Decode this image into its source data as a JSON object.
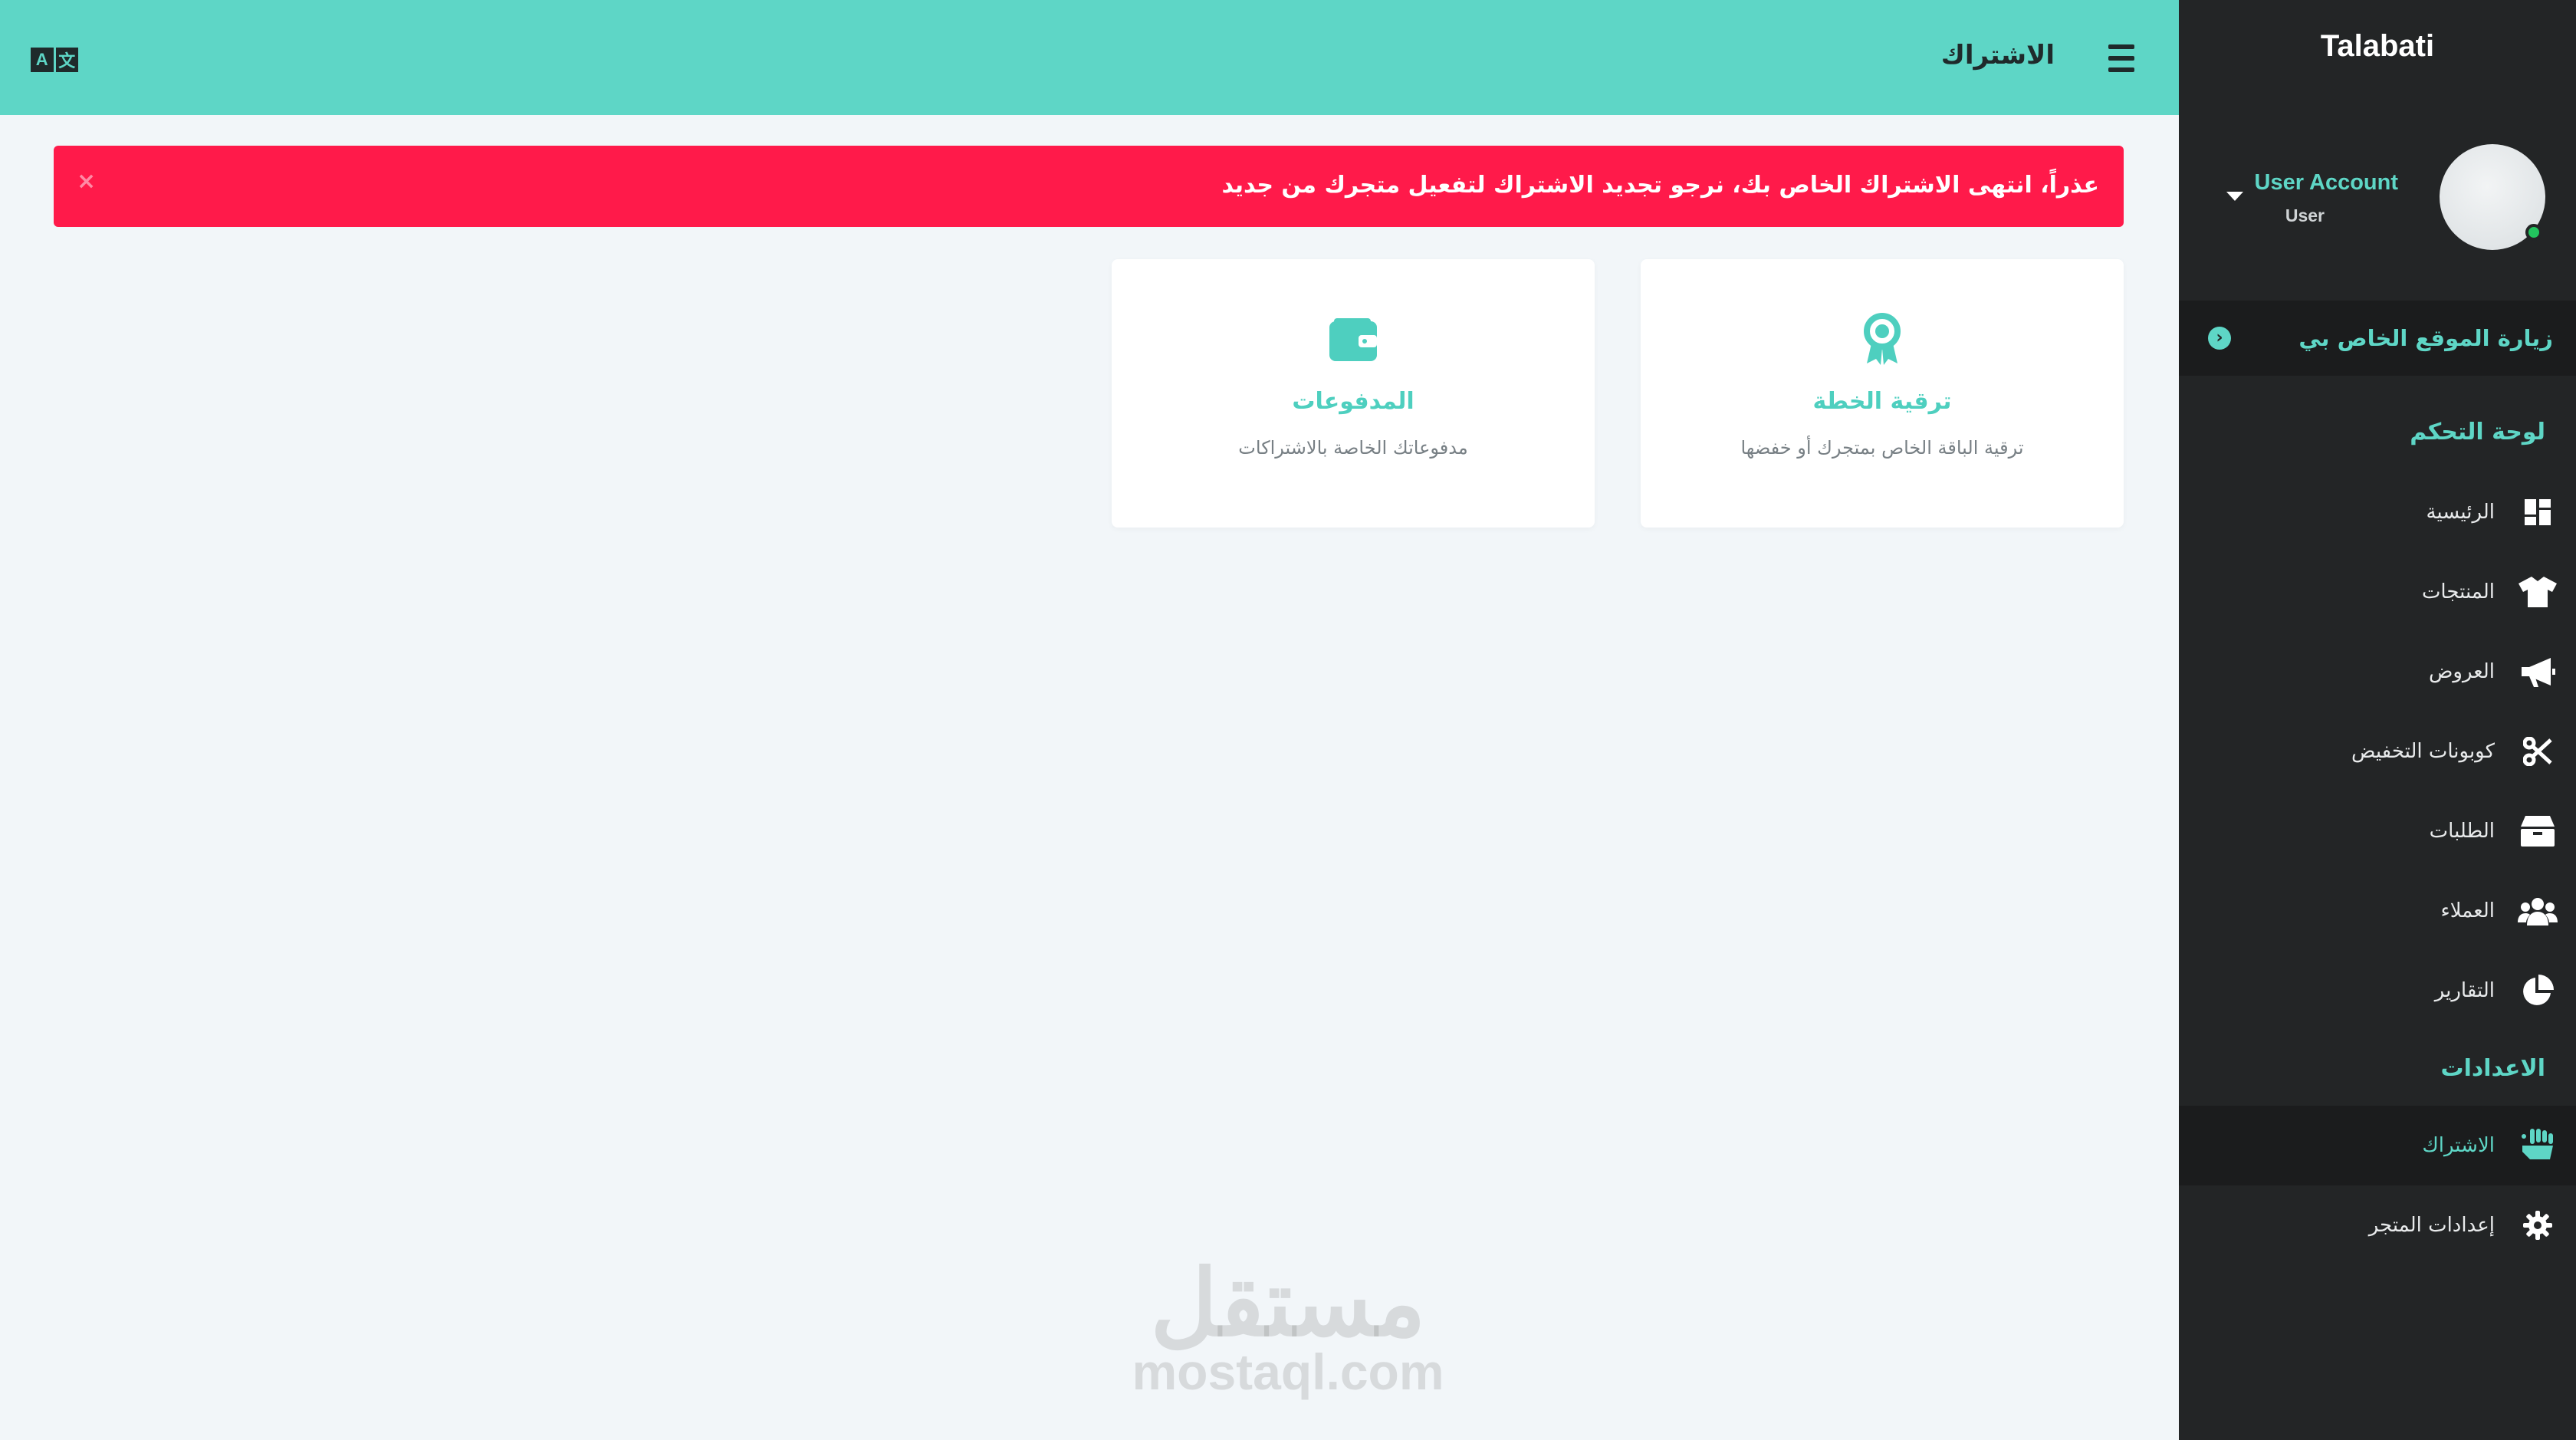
{
  "topbar": {
    "title": "الاشتراك",
    "lang_icon_left": "A",
    "lang_icon_right": "文"
  },
  "alert": {
    "message": "عذراً، انتهى الاشتراك الخاص بك، نرجو تجديد الاشتراك لتفعيل متجرك من جديد",
    "close": "×"
  },
  "cards": [
    {
      "title": "ترقية الخطة",
      "description": "ترقية الباقة الخاص بمتجرك أو خفضها",
      "icon": "award-icon"
    },
    {
      "title": "المدفوعات",
      "description": "مدفوعاتك الخاصة بالاشتراكات",
      "icon": "wallet-icon"
    }
  ],
  "sidebar": {
    "brand": "Talabati",
    "user": {
      "name": "User Account",
      "role": "User"
    },
    "visit_site": "زيارة الموقع الخاص بي",
    "sections": {
      "dashboard": "لوحة التحكم",
      "settings": "الاعدادات"
    },
    "items": [
      {
        "label": "الرئيسية",
        "icon": "dashboard-icon"
      },
      {
        "label": "المنتجات",
        "icon": "tshirt-icon"
      },
      {
        "label": "العروض",
        "icon": "megaphone-icon"
      },
      {
        "label": "كوبونات التخفيض",
        "icon": "scissors-icon"
      },
      {
        "label": "الطلبات",
        "icon": "box-icon"
      },
      {
        "label": "العملاء",
        "icon": "users-icon"
      },
      {
        "label": "التقارير",
        "icon": "pie-chart-icon"
      }
    ],
    "settings_items": [
      {
        "label": "الاشتراك",
        "icon": "hand-holding-icon",
        "active": true
      },
      {
        "label": "إعدادات المتجر",
        "icon": "gear-icon"
      }
    ]
  },
  "watermark": {
    "ar": "مستقل",
    "en": "mostaql.com"
  },
  "colors": {
    "accent": "#5ed6c6",
    "sidebar": "#232526",
    "alert": "#ff1a4a",
    "background": "#f2f6f9"
  }
}
